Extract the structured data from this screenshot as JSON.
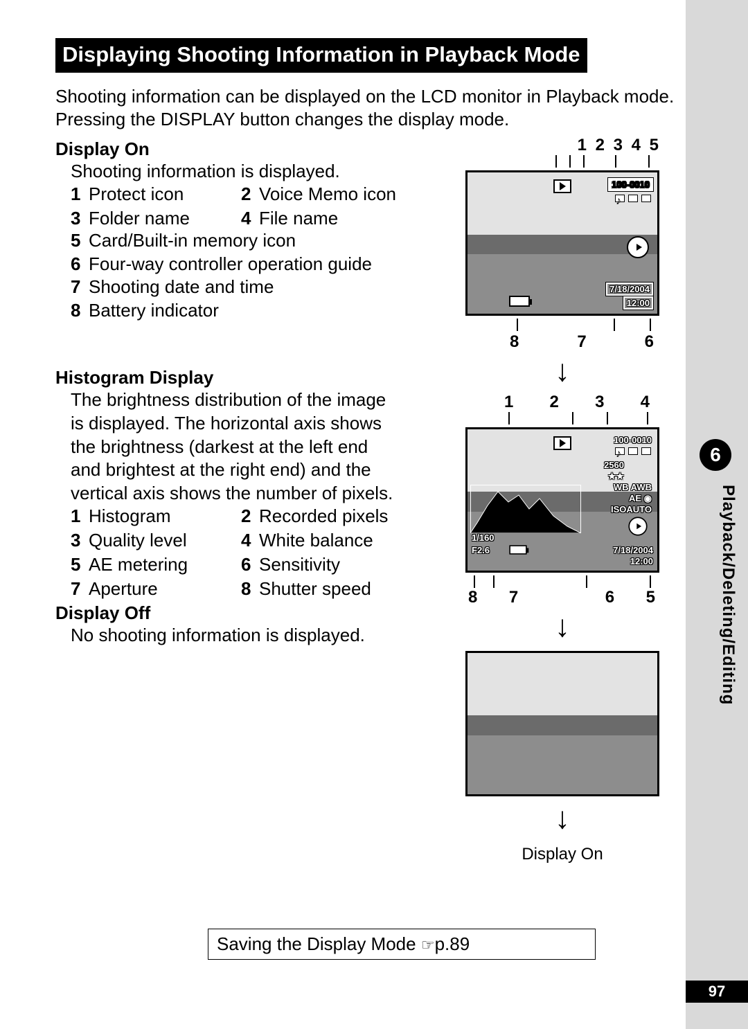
{
  "chapter": {
    "number": "6",
    "title": "Playback/Deleting/Editing"
  },
  "page_number": "97",
  "heading": "Displaying Shooting Information in Playback Mode",
  "intro": "Shooting information can be displayed on the LCD monitor in Playback mode. Pressing the DISPLAY button changes the display mode.",
  "display_on": {
    "title": "Display On",
    "desc": "Shooting information is displayed.",
    "items": {
      "1": "Protect icon",
      "2": "Voice Memo icon",
      "3": "Folder name",
      "4": "File name",
      "5": "Card/Built-in memory icon",
      "6": "Four-way controller operation guide",
      "7": "Shooting date and time",
      "8": "Battery indicator"
    },
    "top_callouts": "1 2 3  4  5",
    "bot_callouts": {
      "a": "8",
      "b": "7",
      "c": "6"
    }
  },
  "histogram": {
    "title": "Histogram Display",
    "desc": "The brightness distribution of the image is displayed. The horizontal axis shows the brightness (darkest at the left end and brightest at the right end) and the vertical axis shows the number of pixels.",
    "items": {
      "1": "Histogram",
      "2": "Recorded pixels",
      "3": "Quality level",
      "4": "White balance",
      "5": "AE metering",
      "6": "Sensitivity",
      "7": "Aperture",
      "8": "Shutter speed"
    },
    "top_callouts": {
      "a": "1",
      "b": "2",
      "c": "3",
      "d": "4"
    },
    "bot_callouts": {
      "a": "8",
      "b": "7",
      "c": "6",
      "d": "5"
    }
  },
  "display_off": {
    "title": "Display Off",
    "desc": "No shooting information is displayed."
  },
  "cycle_back_label": "Display On",
  "lcd": {
    "folder_file": "100-0010",
    "date": "7/18/2004",
    "time": "12:00",
    "pixels": "2560",
    "wb_label": "WB",
    "wb_val": "AWB",
    "ae_label": "AE",
    "iso_label": "ISO",
    "iso_val": "AUTO",
    "shutter": "1/160",
    "aperture": "F2.6"
  },
  "reference": {
    "text": "Saving the Display Mode ",
    "page": "p.89"
  }
}
